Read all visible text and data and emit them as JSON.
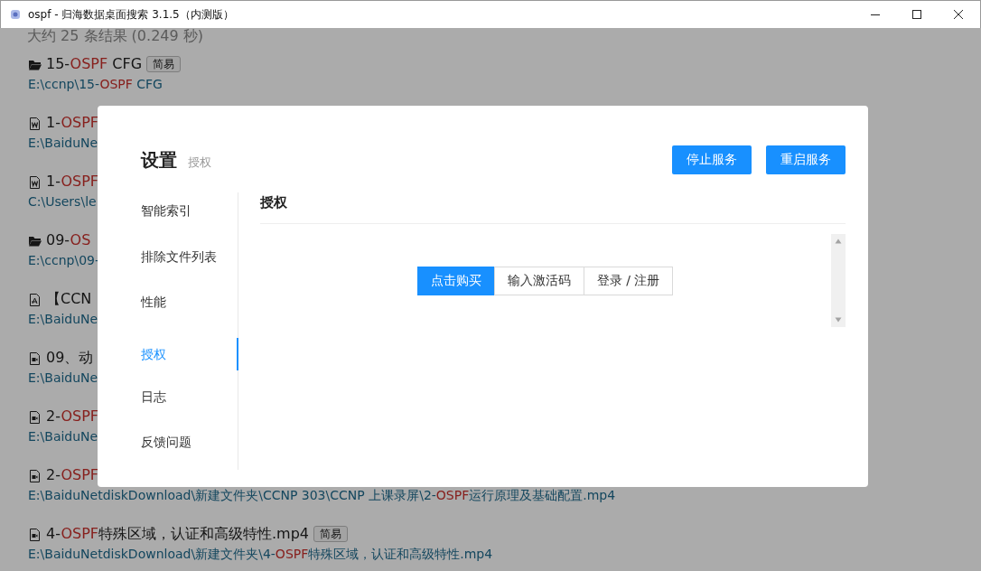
{
  "window": {
    "title": "ospf - 归海数据桌面搜索 3.1.5（内测版）"
  },
  "results": {
    "summary": "大约 25 条结果 (0.249 秒)",
    "items": [
      {
        "kind": "folder",
        "title": [
          {
            "text": "15-",
            "highlight": false
          },
          {
            "text": "OSPF",
            "highlight": true
          },
          {
            "text": " CFG",
            "highlight": false
          }
        ],
        "tag": "简易",
        "path": [
          {
            "text": "E:\\ccnp\\15-",
            "highlight": false
          },
          {
            "text": "OSPF",
            "highlight": true
          },
          {
            "text": " CFG",
            "highlight": false
          }
        ]
      },
      {
        "kind": "word",
        "title": [
          {
            "text": "1-",
            "highlight": false
          },
          {
            "text": "OSPF",
            "highlight": true
          }
        ],
        "path": [
          {
            "text": "E:\\BaiduNe",
            "highlight": false
          }
        ]
      },
      {
        "kind": "word",
        "title": [
          {
            "text": "1-",
            "highlight": false
          },
          {
            "text": "OSPF",
            "highlight": true
          }
        ],
        "path": [
          {
            "text": "C:\\Users\\le",
            "highlight": false
          }
        ]
      },
      {
        "kind": "folder",
        "title": [
          {
            "text": "09-",
            "highlight": false
          },
          {
            "text": "OS",
            "highlight": true
          }
        ],
        "path": [
          {
            "text": "E:\\ccnp\\09-",
            "highlight": false
          }
        ]
      },
      {
        "kind": "pdf",
        "title": [
          {
            "text": "【CCN",
            "highlight": false
          }
        ],
        "path": [
          {
            "text": "E:\\BaiduNe",
            "highlight": false
          }
        ]
      },
      {
        "kind": "video",
        "title": [
          {
            "text": "09、动",
            "highlight": false
          }
        ],
        "path": [
          {
            "text": "E:\\BaiduNe",
            "highlight": false
          }
        ]
      },
      {
        "kind": "video",
        "title": [
          {
            "text": "2-",
            "highlight": false
          },
          {
            "text": "OSPF",
            "highlight": true
          }
        ],
        "path": [
          {
            "text": "E:\\BaiduNe",
            "highlight": false
          }
        ]
      },
      {
        "kind": "video",
        "title": [
          {
            "text": "2-",
            "highlight": false
          },
          {
            "text": "OSPF",
            "highlight": true
          }
        ],
        "path": [
          {
            "text": "E:\\BaiduNetdiskDownload\\新建文件夹\\CCNP 303\\CCNP 上课录屏\\2-",
            "highlight": false
          },
          {
            "text": "OSPF",
            "highlight": true
          },
          {
            "text": "运行原理及基础配置.mp4",
            "highlight": false
          }
        ]
      },
      {
        "kind": "video",
        "title": [
          {
            "text": "4-",
            "highlight": false
          },
          {
            "text": "OSPF",
            "highlight": true
          },
          {
            "text": "特殊区域，认证和高级特性.mp4",
            "highlight": false
          }
        ],
        "tag": "简易",
        "path": [
          {
            "text": "E:\\BaiduNetdiskDownload\\新建文件夹\\4-",
            "highlight": false
          },
          {
            "text": "OSPF",
            "highlight": true
          },
          {
            "text": "特殊区域，认证和高级特性.mp4",
            "highlight": false
          }
        ]
      }
    ]
  },
  "settings": {
    "title": "设置",
    "breadcrumb": "授权",
    "buttons": [
      "停止服务",
      "重启服务"
    ],
    "menu": [
      {
        "label": "智能索引",
        "selected": false
      },
      {
        "label": "排除文件列表",
        "selected": false
      },
      {
        "label": "性能",
        "selected": false
      },
      {
        "label": "授权",
        "selected": true
      },
      {
        "label": "日志",
        "selected": false
      },
      {
        "label": "反馈问题",
        "selected": false
      }
    ],
    "section_title": "授权",
    "actions": [
      {
        "label": "点击购买",
        "primary": true
      },
      {
        "label": "输入激活码",
        "primary": false
      },
      {
        "label": "登录 / 注册",
        "primary": false
      }
    ]
  }
}
